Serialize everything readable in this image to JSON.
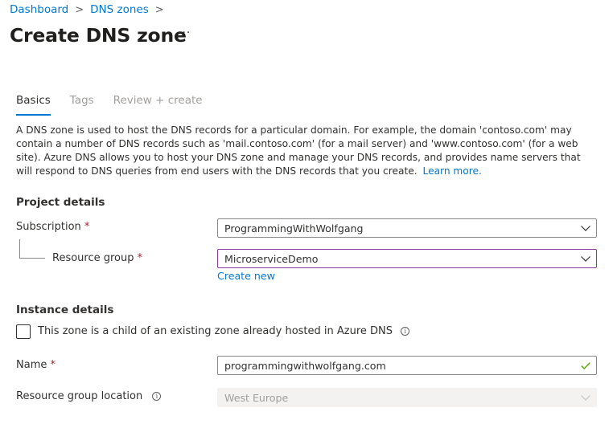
{
  "breadcrumb": [
    {
      "label": "Dashboard"
    },
    {
      "label": "DNS zones"
    }
  ],
  "breadcrumb_separator": ">",
  "page_title": "Create DNS zone",
  "more_label": "···",
  "tabs": [
    {
      "label": "Basics",
      "state": "active"
    },
    {
      "label": "Tags",
      "state": "disabled"
    },
    {
      "label": "Review + create",
      "state": "disabled"
    }
  ],
  "description": "A DNS zone is used to host the DNS records for a particular domain. For example, the domain 'contoso.com' may contain a number of DNS records such as 'mail.contoso.com' (for a mail server) and 'www.contoso.com' (for a web site). Azure DNS allows you to host your DNS zone and manage your DNS records, and provides name servers that will respond to DNS queries from end users with the DNS records that you create.",
  "learn_more": "Learn more.",
  "project_details": {
    "heading": "Project details",
    "subscription_label": "Subscription",
    "subscription_value": "ProgrammingWithWolfgang",
    "resource_group_label": "Resource group",
    "resource_group_value": "MicroserviceDemo",
    "create_new": "Create new"
  },
  "required_marker": "*",
  "instance_details": {
    "heading": "Instance details",
    "child_zone_label": "This zone is a child of an existing zone already hosted in Azure DNS",
    "child_zone_checked": false,
    "name_label": "Name",
    "name_value": "programmingwithwolfgang.com",
    "location_label": "Resource group location",
    "location_value": "West Europe"
  },
  "info_glyph": "i",
  "colors": {
    "accent": "#0078d4",
    "required": "#a4262c",
    "valid": "#57a300",
    "focus_border": "#8a3b9e"
  }
}
